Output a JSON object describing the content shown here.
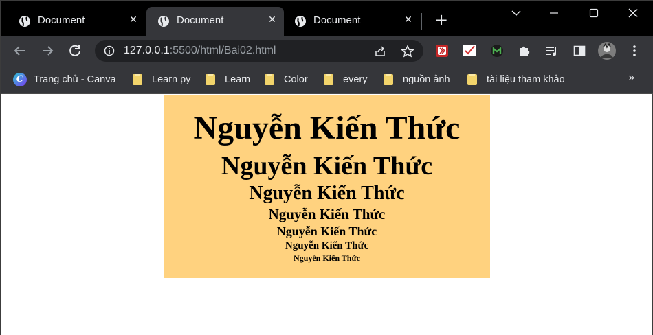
{
  "browser": {
    "tabs": [
      {
        "title": "Document",
        "active": false,
        "icon": "globe-icon"
      },
      {
        "title": "Document",
        "active": true,
        "icon": "globe-icon"
      },
      {
        "title": "Document",
        "active": false,
        "icon": "globe-icon"
      }
    ],
    "tab_close_glyph": "✕",
    "new_tab_glyph": "+",
    "window_controls": {
      "dropdown": "chevron-down-icon",
      "minimize": "minimize-icon",
      "maximize": "maximize-icon",
      "close": "close-icon"
    },
    "address": {
      "host": "127.0.0.1",
      "rest": ":5500/html/Bai02.html"
    },
    "extensions": [
      "extension-red-icon",
      "extension-check-icon",
      "extension-green-icon",
      "puzzle-icon",
      "media-icon",
      "sidepanel-icon",
      "profile-avatar",
      "menu-icon"
    ]
  },
  "bookmarks": [
    {
      "label": "Trang chủ - Canva",
      "icon": "canva-icon"
    },
    {
      "label": "Learn py",
      "icon": "folder-icon"
    },
    {
      "label": "Learn",
      "icon": "folder-icon"
    },
    {
      "label": "Color",
      "icon": "folder-icon"
    },
    {
      "label": "every",
      "icon": "folder-icon"
    },
    {
      "label": "nguồn ảnh",
      "icon": "folder-icon"
    },
    {
      "label": "tài liệu tham khảo",
      "icon": "folder-icon"
    }
  ],
  "bookmarks_more": "»",
  "canva_letter": "C",
  "page": {
    "background_color": "#ffd27f",
    "headings": [
      "Nguyễn Kiến Thức",
      "Nguyễn Kiến Thức",
      "Nguyễn Kiến Thức",
      "Nguyễn Kiến Thức",
      "Nguyễn Kiến Thức",
      "Nguyễn Kiến Thức",
      "Nguyễn Kiến Thức"
    ]
  }
}
